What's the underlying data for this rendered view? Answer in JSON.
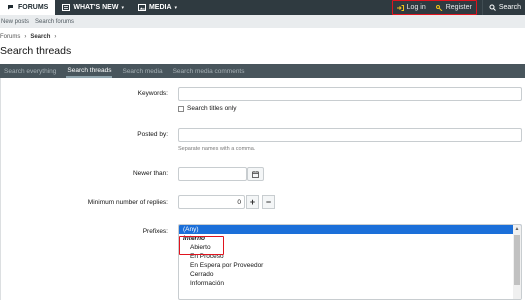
{
  "topnav": {
    "forums": "FORUMS",
    "whats_new": "WHAT'S NEW",
    "media": "MEDIA",
    "login": "Log in",
    "register": "Register",
    "search": "Search"
  },
  "subnav": {
    "new_posts": "New posts",
    "search_forums": "Search forums"
  },
  "breadcrumb": {
    "forums": "Forums",
    "search": "Search"
  },
  "page_title": "Search threads",
  "tabs": [
    "Search everything",
    "Search threads",
    "Search media",
    "Search media comments"
  ],
  "form": {
    "keywords_label": "Keywords:",
    "titles_only": "Search titles only",
    "posted_by_label": "Posted by:",
    "posted_by_hint": "Separate names with a comma.",
    "newer_than_label": "Newer than:",
    "min_replies_label": "Minimum number of replies:",
    "min_replies_value": "0",
    "prefixes_label": "Prefixes:",
    "prefixes": [
      "(Any)",
      "Interno",
      "Abierto",
      "En Proceso",
      "En Espera por Proveedor",
      "Cerrado",
      "Información"
    ]
  },
  "colors": {
    "accent_red": "#e0141e",
    "nav_bg": "#2f3a40",
    "tab_bg": "#48555c",
    "selected": "#1b6fd9"
  }
}
